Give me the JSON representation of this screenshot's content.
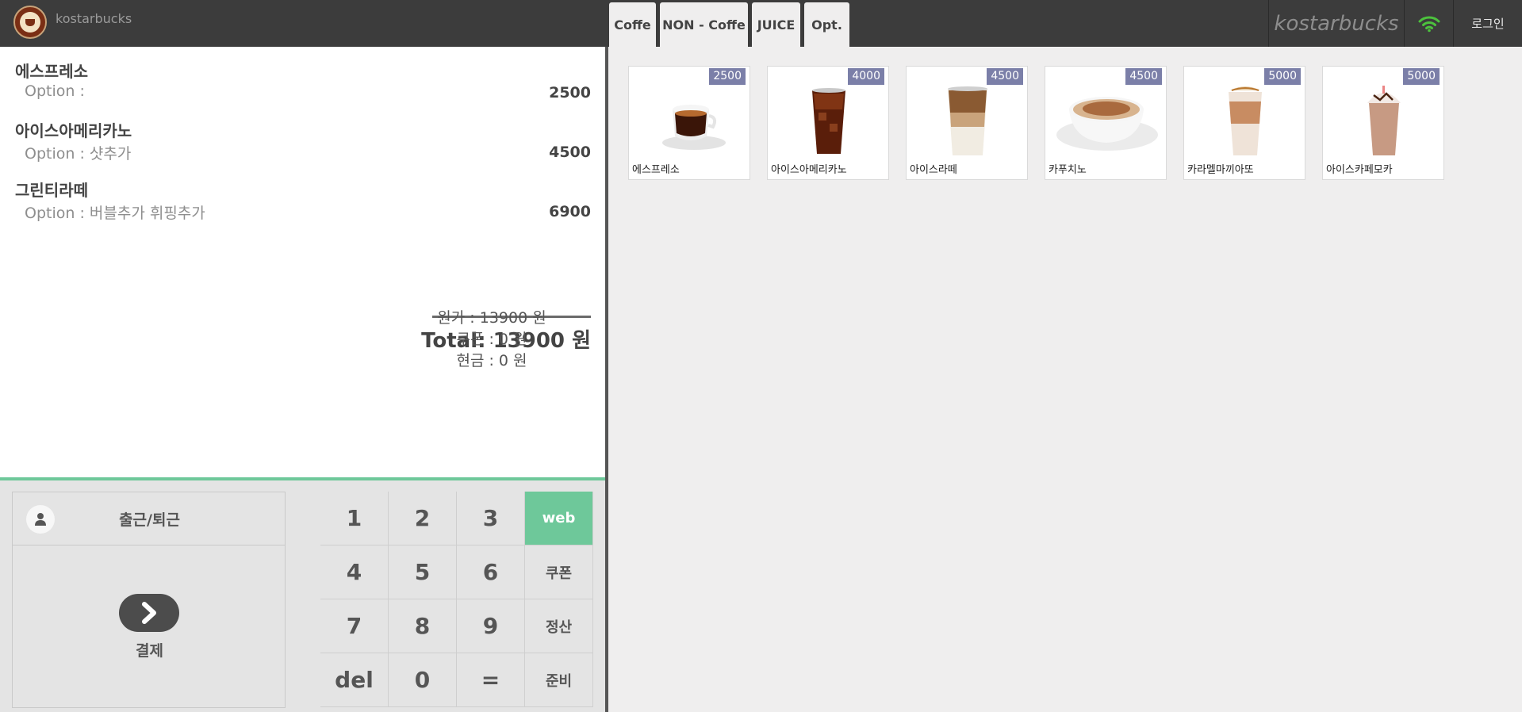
{
  "header": {
    "brand_small": "kostarbucks",
    "brand": "kostarbucks",
    "login_label": "로그인",
    "tabs": [
      {
        "label": "Coffe"
      },
      {
        "label": "NON - Coffe"
      },
      {
        "label": "JUICE"
      },
      {
        "label": "Opt."
      }
    ]
  },
  "order": {
    "items": [
      {
        "name": "에스프레소",
        "option": "Option :",
        "price": "2500"
      },
      {
        "name": "아이스아메리카노",
        "option": "Option : 샷추가",
        "price": "4500"
      },
      {
        "name": "그린티라떼",
        "option": "Option : 버블추가 휘핑추가",
        "price": "6900"
      }
    ],
    "total": "Total: 13900 원",
    "original": "원가 : 13900 원",
    "coupon": "쿠폰 : 0 원",
    "cash": "현금 : 0 원"
  },
  "controls": {
    "clock_label": "출근/퇴근",
    "pay_label": "결제",
    "keys": [
      "1",
      "2",
      "3",
      "web",
      "4",
      "5",
      "6",
      "쿠폰",
      "7",
      "8",
      "9",
      "정산",
      "del",
      "0",
      "=",
      "준비"
    ]
  },
  "menu": [
    {
      "name": "에스프레소",
      "price": "2500"
    },
    {
      "name": "아이스아메리카노",
      "price": "4000"
    },
    {
      "name": "아이스라떼",
      "price": "4500"
    },
    {
      "name": "카푸치노",
      "price": "4500"
    },
    {
      "name": "카라멜마끼아또",
      "price": "5000"
    },
    {
      "name": "아이스카페모카",
      "price": "5000"
    }
  ],
  "colors": {
    "topbar": "#3c3c3c",
    "accent_green": "#6ec89a",
    "badge": "#7b7fa8",
    "wifi": "#4cc23d"
  },
  "icons": [
    "logo-icon",
    "wifi-icon",
    "user-icon",
    "chevron-right-icon"
  ]
}
